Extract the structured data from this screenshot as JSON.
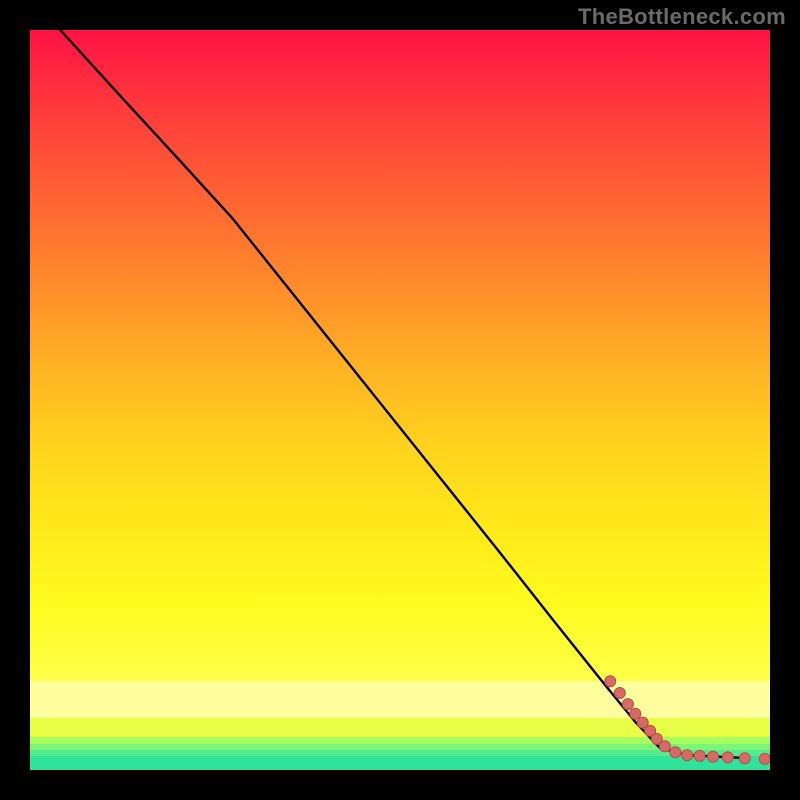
{
  "watermark": "TheBottleneck.com",
  "colors": {
    "frame": "#000000",
    "curve": "#000000",
    "dot_fill": "#d86a66",
    "dot_stroke": "#b94c48"
  },
  "chart_data": {
    "type": "line",
    "title": "",
    "xlabel": "",
    "ylabel": "",
    "xlim": [
      0,
      100
    ],
    "ylim": [
      0,
      100
    ],
    "grid": false,
    "legend": false,
    "notes": "Background is a vertical gradient from red (top) through orange/yellow to pale yellow then thin green bands at the bottom. Axes, ticks, and labels are not shown; values are normalized 0–100 in both directions and estimated from pixel positions.",
    "series": [
      {
        "name": "curve",
        "style": "solid-black",
        "points": [
          {
            "x": 4.1,
            "y": 100.0
          },
          {
            "x": 12.2,
            "y": 91.1
          },
          {
            "x": 20.3,
            "y": 82.3
          },
          {
            "x": 27.4,
            "y": 74.5
          },
          {
            "x": 34.6,
            "y": 65.5
          },
          {
            "x": 41.8,
            "y": 56.5
          },
          {
            "x": 49.0,
            "y": 47.5
          },
          {
            "x": 56.2,
            "y": 38.5
          },
          {
            "x": 63.4,
            "y": 29.5
          },
          {
            "x": 70.5,
            "y": 20.5
          },
          {
            "x": 77.7,
            "y": 11.5
          },
          {
            "x": 81.8,
            "y": 6.5
          },
          {
            "x": 85.1,
            "y": 3.0
          },
          {
            "x": 88.8,
            "y": 2.0
          },
          {
            "x": 93.0,
            "y": 1.8
          },
          {
            "x": 97.0,
            "y": 1.6
          }
        ]
      }
    ],
    "scatter": [
      {
        "x": 78.4,
        "y": 12.0
      },
      {
        "x": 79.7,
        "y": 10.4
      },
      {
        "x": 80.8,
        "y": 8.9
      },
      {
        "x": 81.8,
        "y": 7.6
      },
      {
        "x": 82.8,
        "y": 6.4
      },
      {
        "x": 83.8,
        "y": 5.3
      },
      {
        "x": 84.7,
        "y": 4.2
      },
      {
        "x": 85.8,
        "y": 3.2
      },
      {
        "x": 87.2,
        "y": 2.4
      },
      {
        "x": 88.8,
        "y": 2.0
      },
      {
        "x": 90.5,
        "y": 1.9
      },
      {
        "x": 92.3,
        "y": 1.8
      },
      {
        "x": 94.3,
        "y": 1.7
      },
      {
        "x": 96.6,
        "y": 1.6
      },
      {
        "x": 99.3,
        "y": 1.5
      }
    ]
  }
}
